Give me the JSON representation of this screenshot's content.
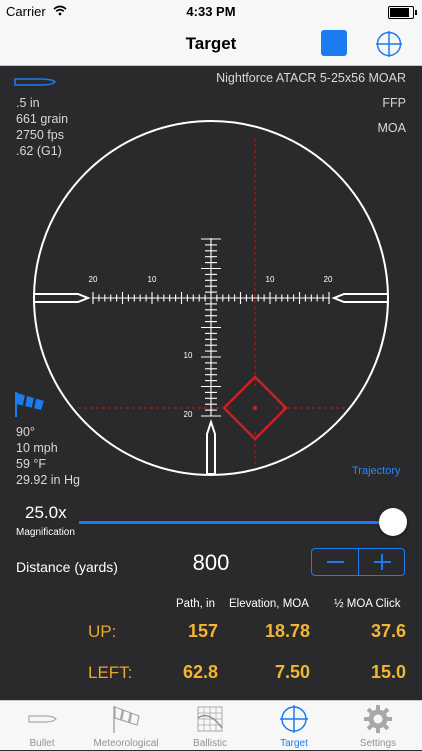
{
  "status_bar": {
    "carrier": "Carrier",
    "time": "4:33 PM"
  },
  "nav": {
    "title": "Target"
  },
  "scope": {
    "name": "Nightforce ATACR 5-25x56 MOAR",
    "plane": "FFP",
    "units": "MOA"
  },
  "bullet": {
    "diameter": ".5 in",
    "weight": "661 grain",
    "velocity": "2750 fps",
    "bc": ".62 (G1)"
  },
  "weather": {
    "wind_direction": "90°",
    "wind_speed": "10 mph",
    "temperature": "59 °F",
    "pressure": "29.92 in Hg"
  },
  "reticle": {
    "left_ticks": [
      "20",
      "10"
    ],
    "right_ticks": [
      "10",
      "20"
    ],
    "down_ticks": [
      "10",
      "20"
    ]
  },
  "trajectory_link": "Trajectory",
  "magnification": {
    "value": "25.0x",
    "label": "Magnification",
    "fraction": 1.0
  },
  "distance": {
    "label": "Distance (yards)",
    "value": "800"
  },
  "table": {
    "headers": [
      "Path, in",
      "Elevation, MOA",
      "½ MOA Click"
    ],
    "rows": [
      {
        "label": "UP:",
        "values": [
          "157",
          "18.78",
          "37.6"
        ]
      },
      {
        "label": "LEFT:",
        "values": [
          "62.8",
          "7.50",
          "15.0"
        ]
      }
    ]
  },
  "tabs": [
    {
      "label": "Bullet",
      "icon": "bullet-icon"
    },
    {
      "label": "Meteorological",
      "icon": "windsock-icon"
    },
    {
      "label": "Ballistic",
      "icon": "ballistic-grid-icon"
    },
    {
      "label": "Target",
      "icon": "crosshair-icon",
      "active": true
    },
    {
      "label": "Settings",
      "icon": "gear-icon"
    }
  ],
  "colors": {
    "accent": "#1a7cf0",
    "value": "#f2b632",
    "label": "#e8a82a",
    "impact": "#cc1f1f"
  }
}
